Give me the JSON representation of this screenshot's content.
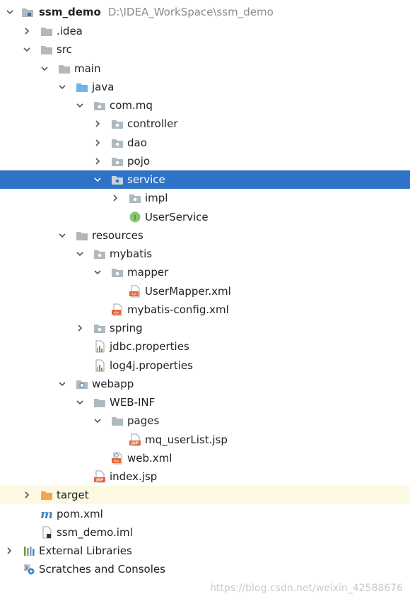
{
  "project": {
    "name": "ssm_demo",
    "path": "D:\\IDEA_WorkSpace\\ssm_demo"
  },
  "tree": {
    "idea": ".idea",
    "src": "src",
    "main": "main",
    "java": "java",
    "com_mq": "com.mq",
    "controller": "controller",
    "dao": "dao",
    "pojo": "pojo",
    "service": "service",
    "impl": "impl",
    "user_service": "UserService",
    "resources": "resources",
    "mybatis": "mybatis",
    "mapper": "mapper",
    "user_mapper_xml": "UserMapper.xml",
    "mybatis_config_xml": "mybatis-config.xml",
    "spring": "spring",
    "jdbc_properties": "jdbc.properties",
    "log4j_properties": "log4j.properties",
    "webapp": "webapp",
    "web_inf": "WEB-INF",
    "pages": "pages",
    "mq_userlist_jsp": "mq_userList.jsp",
    "web_xml": "web.xml",
    "index_jsp": "index.jsp",
    "target": "target",
    "pom_xml": "pom.xml",
    "ssm_demo_iml": "ssm_demo.iml",
    "external_libraries": "External Libraries",
    "scratches": "Scratches and Consoles"
  },
  "icon_text": {
    "interface": "I",
    "jsp": "JSP",
    "xml": "<>",
    "maven": "m"
  },
  "colors": {
    "selection": "#2e73c8",
    "folder": "#aeb9c0",
    "source_folder": "#6eb6e8",
    "excluded_folder": "#f6a44c",
    "excluded_row": "#fbf9e2",
    "interface_icon": "#8ac572",
    "xml_icon": "#e2683c",
    "maven_icon": "#3d87c7"
  },
  "watermark": "https://blog.csdn.net/weixin_42588676"
}
